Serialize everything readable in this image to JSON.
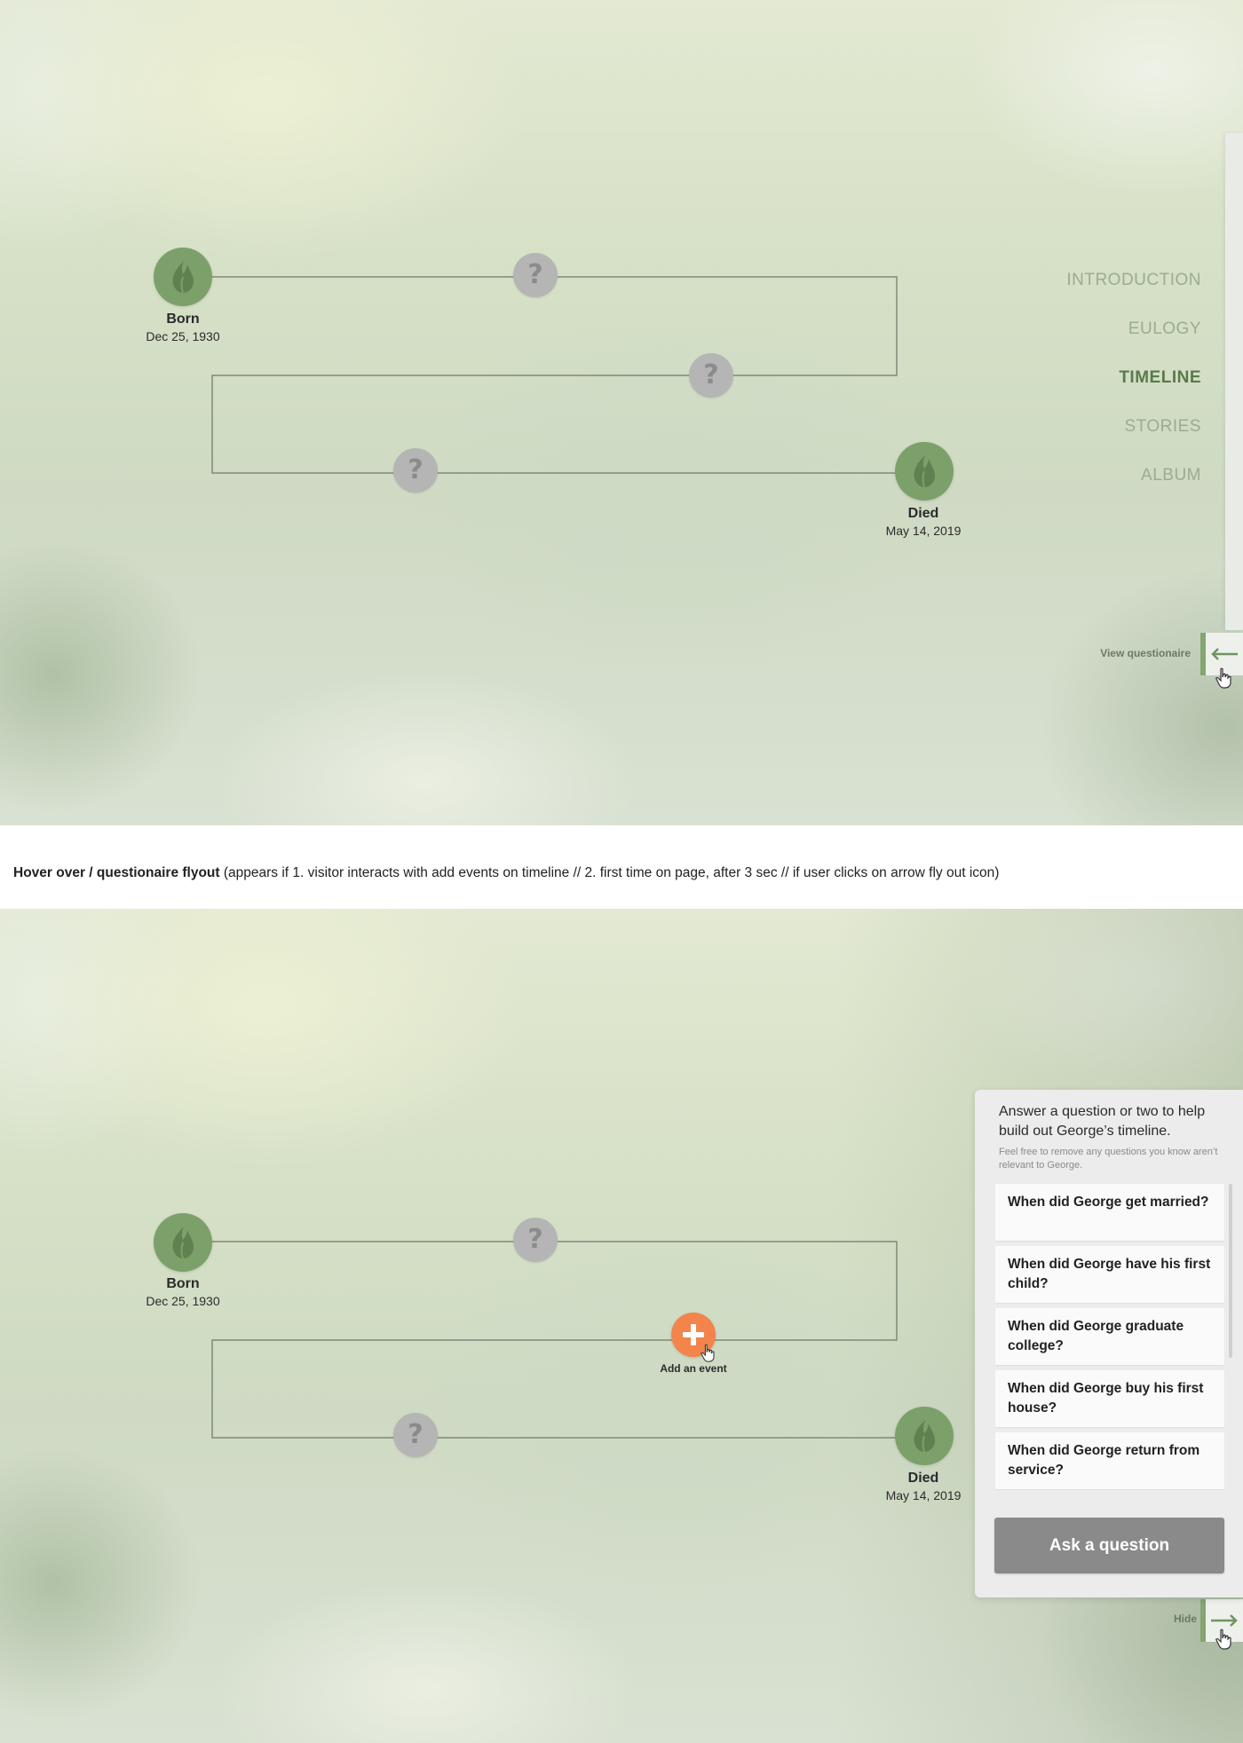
{
  "top_view": {
    "timeline": {
      "born": {
        "title": "Born",
        "date": "Dec 25, 1930"
      },
      "died": {
        "title": "Died",
        "date": "May 14, 2019"
      },
      "unknown_marker": "?"
    },
    "nav": {
      "items": [
        {
          "label": "INTRODUCTION",
          "active": false
        },
        {
          "label": "EULOGY",
          "active": false
        },
        {
          "label": "TIMELINE",
          "active": true
        },
        {
          "label": "STORIES",
          "active": false
        },
        {
          "label": "ALBUM",
          "active": false
        }
      ]
    },
    "questionnaire_tab": {
      "label": "View questionaire",
      "icon": "arrow-left-icon"
    }
  },
  "caption": {
    "bold": "Hover over / questionaire flyout",
    "rest": " (appears if 1. visitor interacts with add events on timeline // 2. first time on page, after 3 sec // if user clicks on arrow fly out icon)"
  },
  "bottom_view": {
    "timeline": {
      "born": {
        "title": "Born",
        "date": "Dec 25, 1930"
      },
      "died": {
        "title": "Died",
        "date": "May 14, 2019"
      },
      "unknown_marker": "?",
      "add_event": {
        "label": "Add an event",
        "icon": "plus-icon"
      }
    },
    "flyout": {
      "heading": "Answer a question or two to help build out George’s timeline.",
      "note": "Feel free to remove any questions you know aren’t relevant to George.",
      "questions": [
        "When did George get married?",
        "When did George have his first child?",
        "When did George graduate college?",
        "When did George buy his first house?",
        "When did George return from service?"
      ],
      "ask_button": "Ask a question"
    },
    "hide_tab": {
      "label": "Hide",
      "icon": "arrow-right-icon"
    }
  },
  "colors": {
    "accent_green": "#7ca06a",
    "nav_active": "#5a7a48",
    "nav_inactive": "#9aad8e",
    "add_event_orange": "#f2844c",
    "unknown_grey": "#b4b5b4"
  }
}
